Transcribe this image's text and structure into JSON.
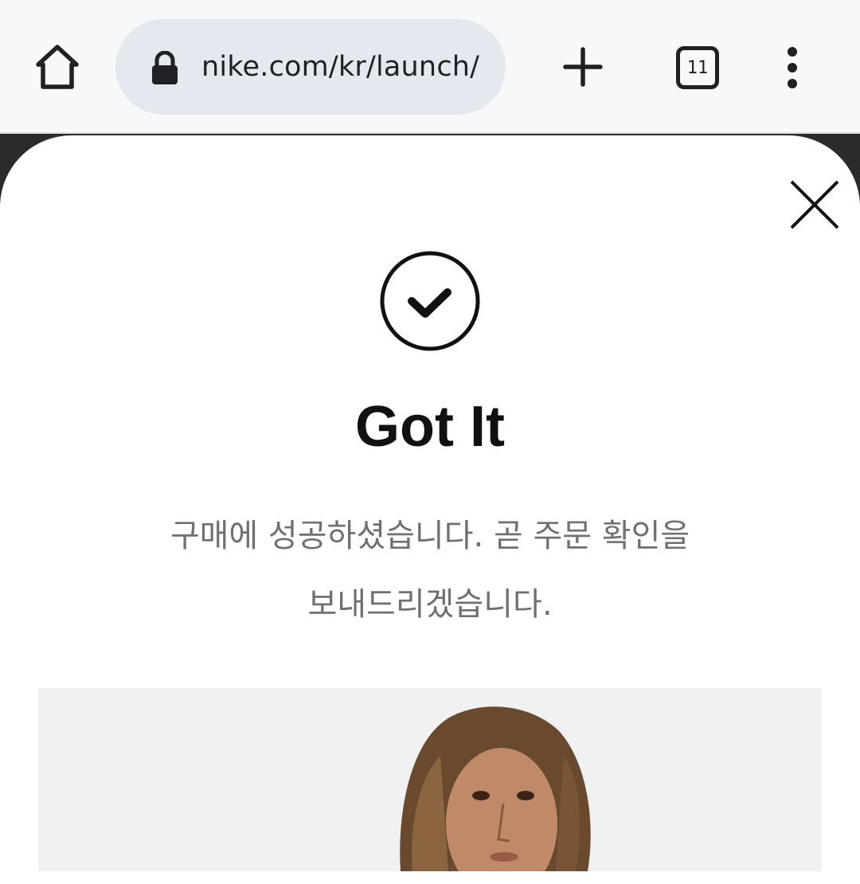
{
  "browser": {
    "url": "nike.com/kr/launch/",
    "tab_count": "11",
    "icons": {
      "home": "home-icon",
      "lock": "lock-icon",
      "new_tab": "plus-icon",
      "tabs": "tab-switcher-icon",
      "menu": "more-vert-icon"
    }
  },
  "modal": {
    "title": "Got It",
    "message_line1": "구매에 성공하셨습니다. 곧 주문 확인을",
    "message_line2": "보내드리겠습니다.",
    "icons": {
      "close": "close-icon",
      "success": "check-circle-icon"
    }
  },
  "colors": {
    "toolbar_bg": "#f7f8fa",
    "omnibox_bg": "#e3e9ef",
    "text_primary": "#111111",
    "text_secondary": "#707070",
    "image_bg": "#f1f1f1"
  }
}
